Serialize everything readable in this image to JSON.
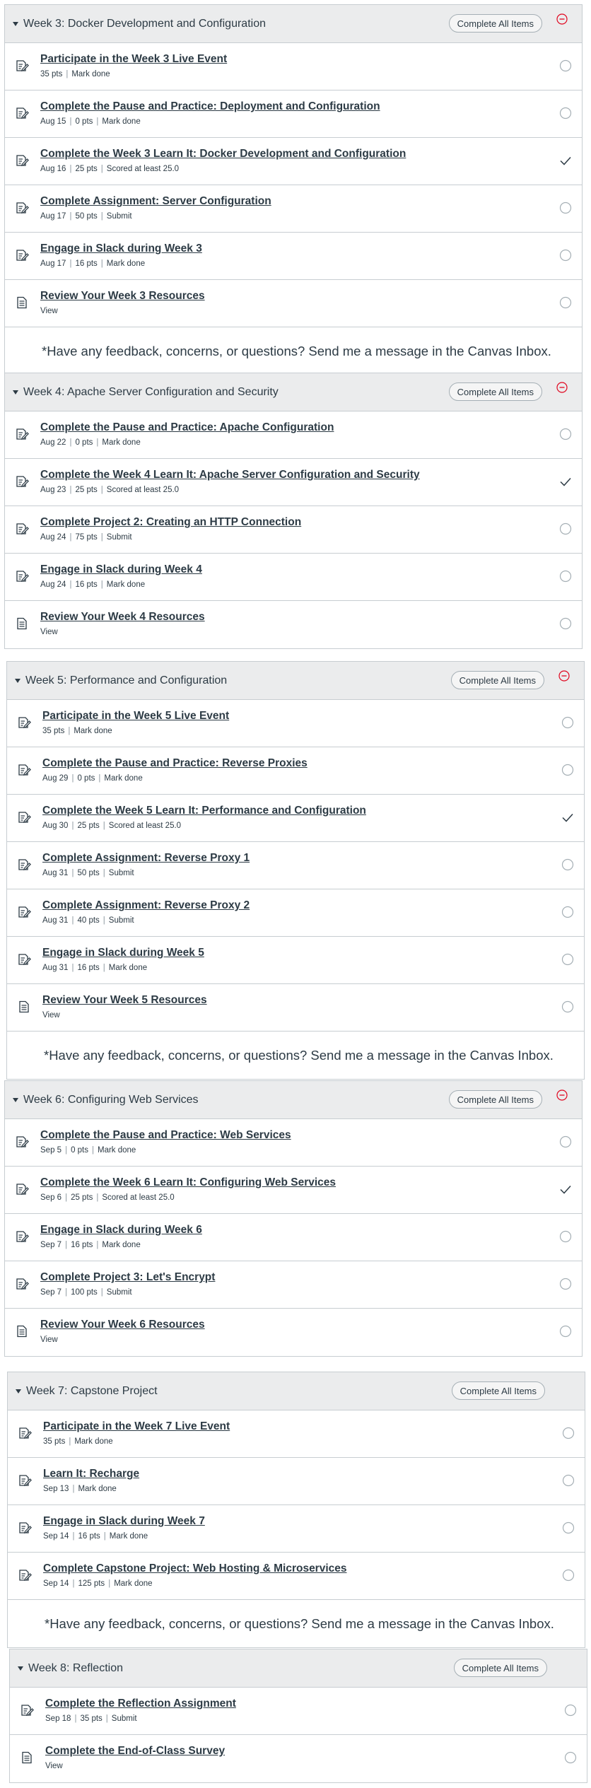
{
  "complete_all_label": "Complete All Items",
  "meta_separator": "|",
  "modules": [
    {
      "title": "Week 3: Docker Development and Configuration",
      "collapse_icon": "minus-circle-icon",
      "items": [
        {
          "title": "Participate in the Week 3 Live Event",
          "meta": [
            "35 pts",
            "Mark done"
          ],
          "icon": "assignment-icon",
          "status": "empty-circle"
        },
        {
          "title": "Complete the Pause and Practice: Deployment and Configuration",
          "meta": [
            "Aug 15",
            "0 pts",
            "Mark done"
          ],
          "icon": "assignment-icon",
          "status": "empty-circle"
        },
        {
          "title": "Complete the Week 3 Learn It: Docker Development and Configuration",
          "meta": [
            "Aug 16",
            "25 pts",
            "Scored at least 25.0"
          ],
          "icon": "assignment-icon",
          "status": "checkmark"
        },
        {
          "title": "Complete Assignment: Server Configuration",
          "meta": [
            "Aug 17",
            "50 pts",
            "Submit"
          ],
          "icon": "assignment-icon",
          "status": "empty-circle"
        },
        {
          "title": "Engage in Slack during Week 3",
          "meta": [
            "Aug 17",
            "16 pts",
            "Mark done"
          ],
          "icon": "assignment-icon",
          "status": "empty-circle"
        },
        {
          "title": "Review Your Week 3 Resources",
          "meta": [
            "View"
          ],
          "icon": "page-icon",
          "status": "empty-circle"
        }
      ],
      "feedback": "*Have any feedback, concerns, or questions? Send me a message in the Canvas Inbox."
    },
    {
      "title": "Week 4: Apache Server Configuration and Security",
      "collapse_icon": "minus-circle-icon",
      "items": [
        {
          "title": "Complete the Pause and Practice: Apache Configuration",
          "meta": [
            "Aug 22",
            "0 pts",
            "Mark done"
          ],
          "icon": "assignment-icon",
          "status": "empty-circle"
        },
        {
          "title": "Complete the Week 4 Learn It: Apache Server Configuration and Security",
          "meta": [
            "Aug 23",
            "25 pts",
            "Scored at least 25.0"
          ],
          "icon": "assignment-icon",
          "status": "checkmark"
        },
        {
          "title": "Complete Project 2: Creating an HTTP Connection",
          "meta": [
            "Aug 24",
            "75 pts",
            "Submit"
          ],
          "icon": "assignment-icon",
          "status": "empty-circle"
        },
        {
          "title": "Engage in Slack during Week 4",
          "meta": [
            "Aug 24",
            "16 pts",
            "Mark done"
          ],
          "icon": "assignment-icon",
          "status": "empty-circle"
        },
        {
          "title": "Review Your Week 4 Resources",
          "meta": [
            "View"
          ],
          "icon": "page-icon",
          "status": "empty-circle"
        }
      ],
      "feedback": ""
    },
    {
      "title": "Week 5: Performance and Configuration",
      "collapse_icon": "minus-circle-icon",
      "items": [
        {
          "title": "Participate in the Week 5 Live Event",
          "meta": [
            "35 pts",
            "Mark done"
          ],
          "icon": "assignment-icon",
          "status": "empty-circle"
        },
        {
          "title": "Complete the Pause and Practice: Reverse Proxies",
          "meta": [
            "Aug 29",
            "0 pts",
            "Mark done"
          ],
          "icon": "assignment-icon",
          "status": "empty-circle"
        },
        {
          "title": "Complete the Week 5 Learn It: Performance and Configuration",
          "meta": [
            "Aug 30",
            "25 pts",
            "Scored at least 25.0"
          ],
          "icon": "assignment-icon",
          "status": "checkmark"
        },
        {
          "title": "Complete Assignment: Reverse Proxy 1",
          "meta": [
            "Aug 31",
            "50 pts",
            "Submit"
          ],
          "icon": "assignment-icon",
          "status": "empty-circle"
        },
        {
          "title": "Complete Assignment: Reverse Proxy 2",
          "meta": [
            "Aug 31",
            "40 pts",
            "Submit"
          ],
          "icon": "assignment-icon",
          "status": "empty-circle"
        },
        {
          "title": "Engage in Slack during Week 5",
          "meta": [
            "Aug 31",
            "16 pts",
            "Mark done"
          ],
          "icon": "assignment-icon",
          "status": "empty-circle"
        },
        {
          "title": "Review Your Week 5 Resources",
          "meta": [
            "View"
          ],
          "icon": "page-icon",
          "status": "empty-circle"
        }
      ],
      "feedback": "*Have any feedback, concerns, or questions? Send me a message in the Canvas Inbox."
    },
    {
      "title": "Week 6: Configuring Web Services",
      "collapse_icon": "minus-circle-icon",
      "items": [
        {
          "title": "Complete the Pause and Practice: Web Services",
          "meta": [
            "Sep 5",
            "0 pts",
            "Mark done"
          ],
          "icon": "assignment-icon",
          "status": "empty-circle"
        },
        {
          "title": "Complete the Week 6 Learn It: Configuring Web Services",
          "meta": [
            "Sep 6",
            "25 pts",
            "Scored at least 25.0"
          ],
          "icon": "assignment-icon",
          "status": "checkmark"
        },
        {
          "title": "Engage in Slack during Week 6",
          "meta": [
            "Sep 7",
            "16 pts",
            "Mark done"
          ],
          "icon": "assignment-icon",
          "status": "empty-circle"
        },
        {
          "title": "Complete Project 3: Let's Encrypt",
          "meta": [
            "Sep 7",
            "100 pts",
            "Submit"
          ],
          "icon": "assignment-icon",
          "status": "empty-circle"
        },
        {
          "title": "Review Your Week 6 Resources",
          "meta": [
            "View"
          ],
          "icon": "page-icon",
          "status": "empty-circle"
        }
      ],
      "feedback": ""
    },
    {
      "title": "Week 7: Capstone Project",
      "collapse_icon": "",
      "items": [
        {
          "title": "Participate in the Week 7 Live Event",
          "meta": [
            "35 pts",
            "Mark done"
          ],
          "icon": "assignment-icon",
          "status": "empty-circle"
        },
        {
          "title": "Learn It: Recharge",
          "meta": [
            "Sep 13",
            "Mark done"
          ],
          "icon": "assignment-icon",
          "status": "empty-circle"
        },
        {
          "title": "Engage in Slack during Week 7",
          "meta": [
            "Sep 14",
            "16 pts",
            "Mark done"
          ],
          "icon": "assignment-icon",
          "status": "empty-circle"
        },
        {
          "title": "Complete Capstone Project: Web Hosting & Microservices",
          "meta": [
            "Sep 14",
            "125 pts",
            "Mark done"
          ],
          "icon": "assignment-icon",
          "status": "empty-circle"
        }
      ],
      "feedback": "*Have any feedback, concerns, or questions? Send me a message in the Canvas Inbox."
    },
    {
      "title": "Week 8: Reflection",
      "collapse_icon": "",
      "items": [
        {
          "title": "Complete the Reflection Assignment",
          "meta": [
            "Sep 18",
            "35 pts",
            "Submit"
          ],
          "icon": "assignment-icon",
          "status": "empty-circle"
        },
        {
          "title": "Complete the End-of-Class Survey",
          "meta": [
            "View"
          ],
          "icon": "page-icon",
          "status": "empty-circle"
        }
      ],
      "feedback": ""
    }
  ]
}
